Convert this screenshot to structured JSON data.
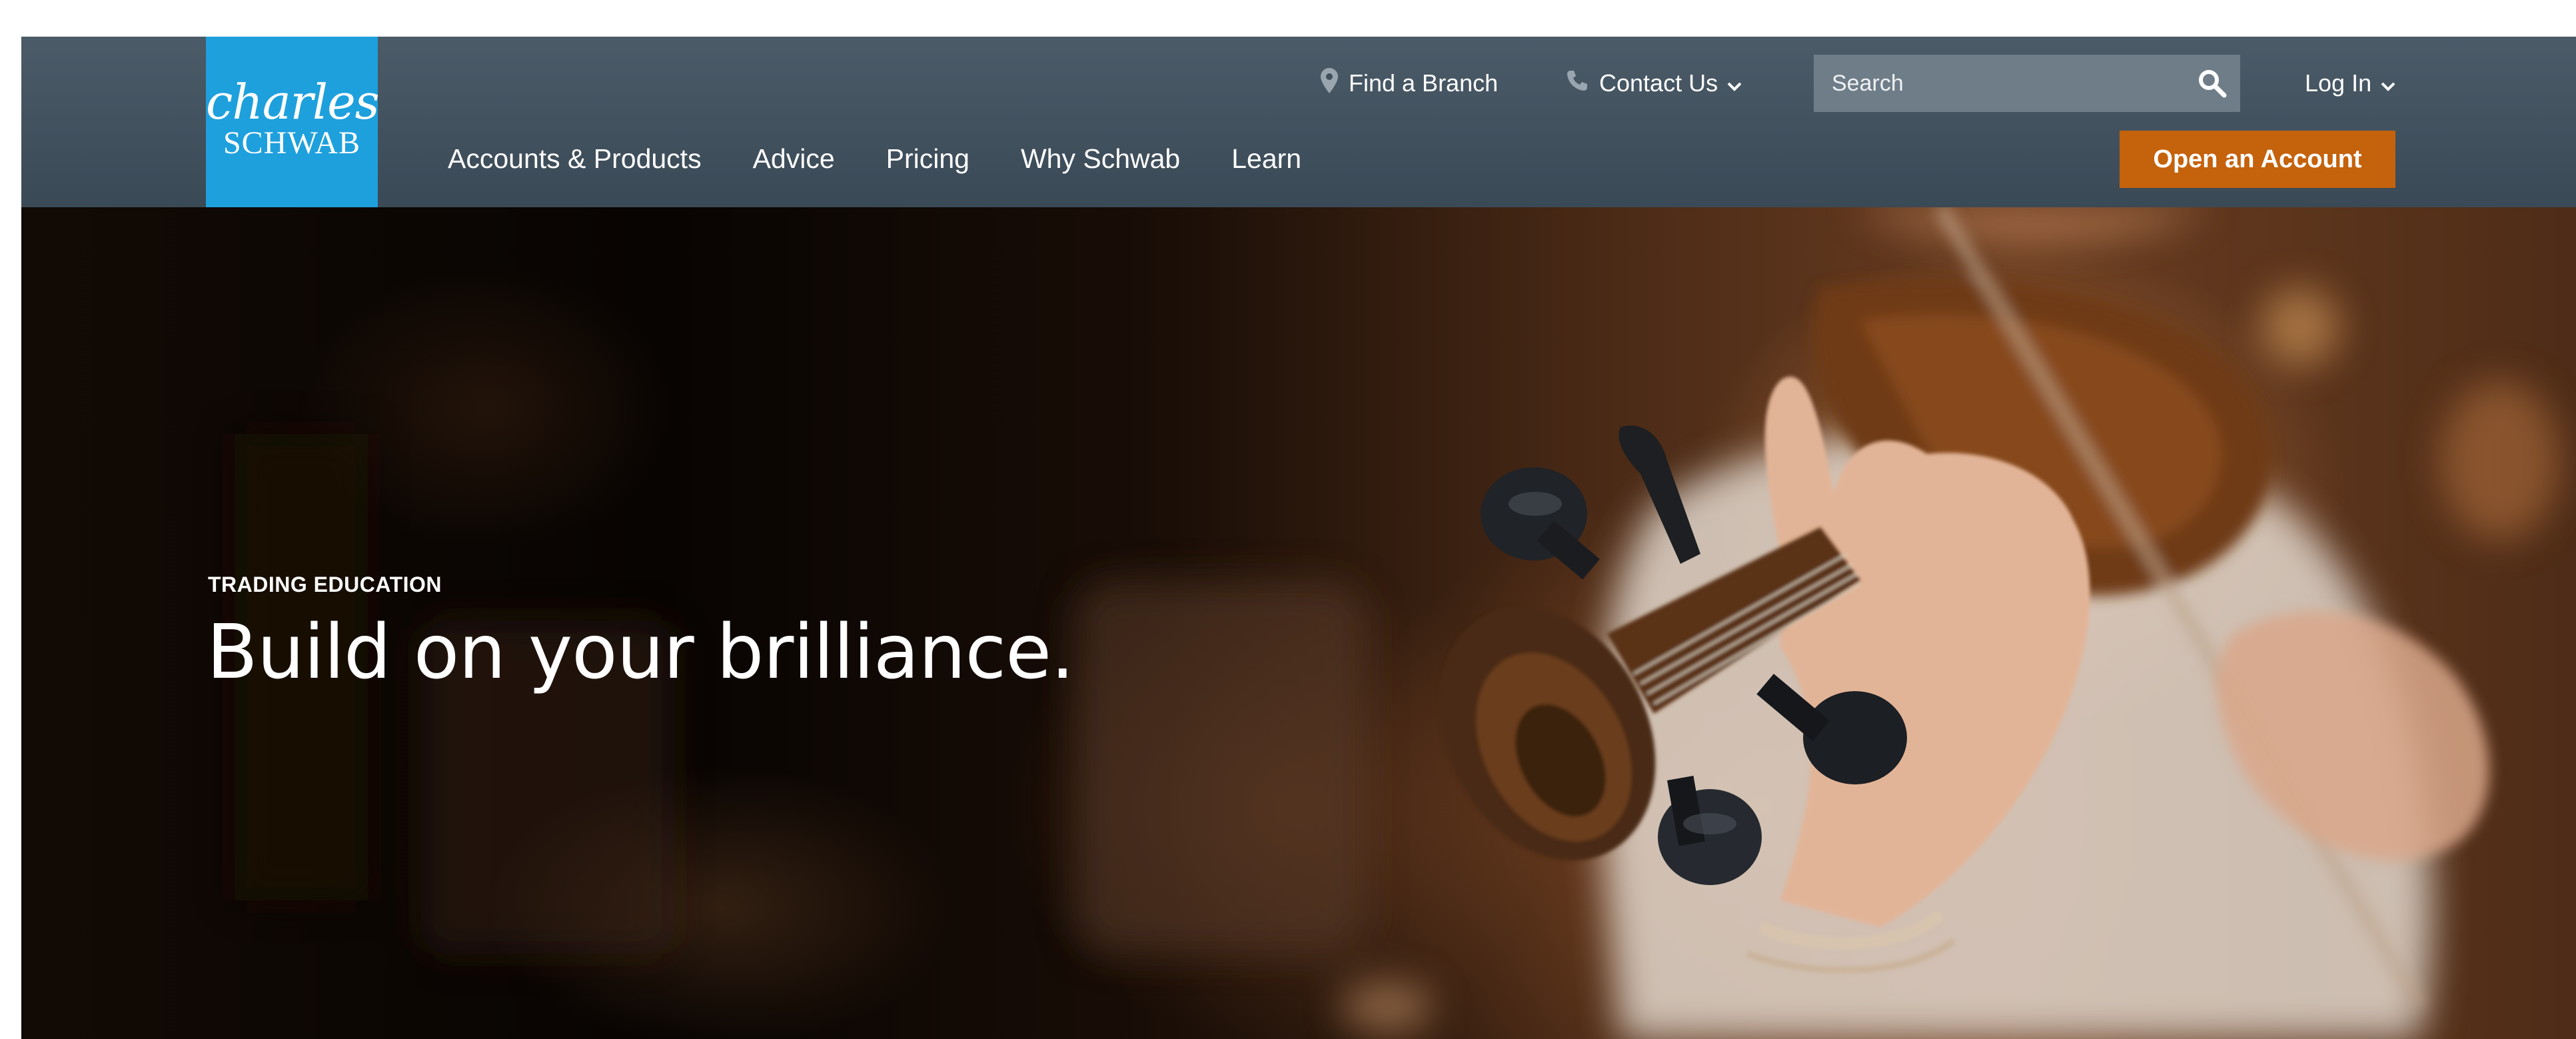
{
  "brand": {
    "logo_line1": "charles",
    "logo_line2": "SCHWAB",
    "color": "#1ea0dd"
  },
  "utility_nav": {
    "find_branch": {
      "label": "Find a Branch",
      "icon": "map-pin-icon"
    },
    "contact": {
      "label": "Contact Us",
      "icon": "phone-icon",
      "dropdown_icon": "chevron-down-icon"
    },
    "search": {
      "placeholder": "Search",
      "value": "",
      "icon": "search-icon"
    },
    "login": {
      "label": "Log In",
      "dropdown_icon": "chevron-down-icon"
    }
  },
  "main_nav": {
    "items": [
      {
        "label": "Accounts & Products"
      },
      {
        "label": "Advice"
      },
      {
        "label": "Pricing"
      },
      {
        "label": "Why Schwab"
      },
      {
        "label": "Learn"
      }
    ]
  },
  "cta": {
    "label": "Open an Account",
    "color": "#c5620c"
  },
  "hero": {
    "eyebrow": "TRADING EDUCATION",
    "headline": "Build on your brilliance.",
    "image": "violinist-photo"
  },
  "colors": {
    "header_bg": "#3f4f5c",
    "search_bg": "#6f7d88"
  }
}
